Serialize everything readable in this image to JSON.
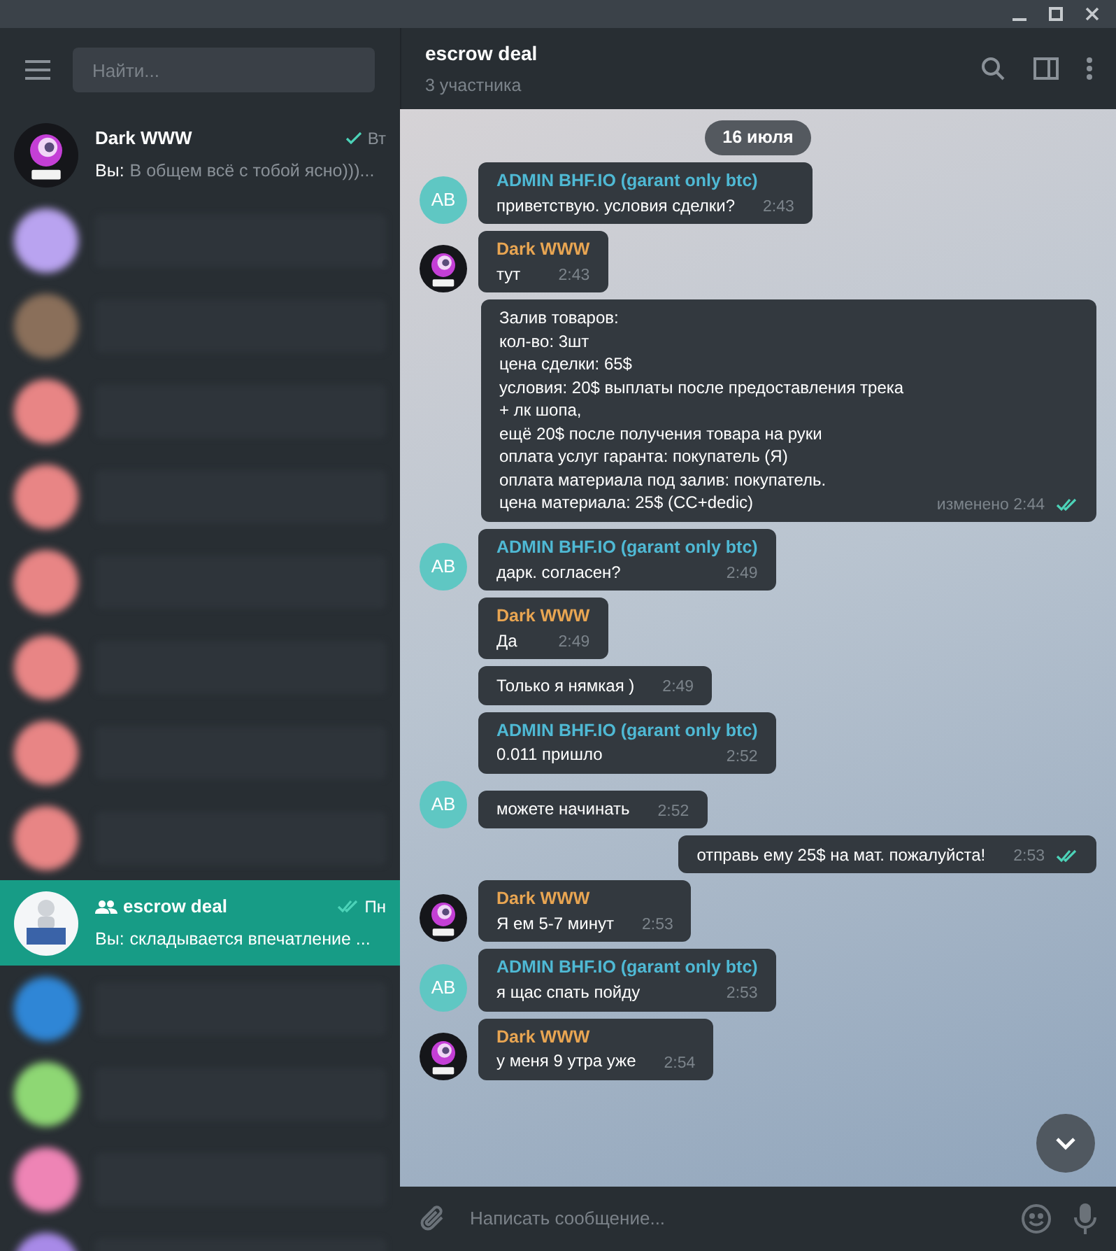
{
  "sidebar": {
    "search": {
      "placeholder": "Найти..."
    },
    "chats": [
      {
        "kind": "chat",
        "name": "Dark WWW",
        "prefix": "Вы:",
        "preview": "В общем всё с тобой ясно)))...",
        "time": "Вт",
        "read": false,
        "selected": false,
        "avatar": {
          "kind": "logo"
        }
      },
      {
        "kind": "blurred",
        "color": "#b9a3f0"
      },
      {
        "kind": "blurred",
        "color": "#8a6f5a"
      },
      {
        "kind": "blurred",
        "color": "#e88585"
      },
      {
        "kind": "blurred",
        "color": "#e88585"
      },
      {
        "kind": "blurred",
        "color": "#e88585"
      },
      {
        "kind": "blurred",
        "color": "#e88585"
      },
      {
        "kind": "blurred",
        "color": "#e88585"
      },
      {
        "kind": "blurred",
        "color": "#e88585"
      },
      {
        "kind": "group",
        "name": "escrow deal",
        "prefix": "Вы:",
        "preview": "складывается впечатление ...",
        "time": "Пн",
        "read": true,
        "selected": true,
        "avatar": {
          "kind": "escrow"
        }
      },
      {
        "kind": "blurred",
        "color": "#2f86d6"
      },
      {
        "kind": "blurred",
        "color": "#8ed774"
      },
      {
        "kind": "blurred",
        "color": "#ee84b5"
      },
      {
        "kind": "blurred",
        "color": "#a88ae8"
      }
    ]
  },
  "chat": {
    "title": "escrow deal",
    "subtitle": "3 участника",
    "date": "16 июля",
    "messages": [
      {
        "out": false,
        "sender": "ADMIN BHF.IO (garant only btc)",
        "color": "#4fb9d4",
        "text": "приветствую. условия сделки?",
        "time": "2:43",
        "avatar": {
          "kind": "initials",
          "text": "AB"
        }
      },
      {
        "out": false,
        "sender": "Dark WWW",
        "color": "#e8a552",
        "text": "тут",
        "time": "2:43",
        "avatar": {
          "kind": "logo"
        }
      },
      {
        "out": true,
        "text": "Залив товаров:\nкол-во: 3шт\nцена сделки: 65$\nусловия: 20$ выплаты после предоставления трека + лк шопа,\nещё 20$ после получения товара на руки\nоплата услуг гаранта: покупатель (Я)\nоплата материала под залив: покупатель.\nцена материала: 25$ (CC+dedic)",
        "time": "изменено 2:44",
        "read": true
      },
      {
        "out": false,
        "sender": "ADMIN BHF.IO (garant only btc)",
        "color": "#4fb9d4",
        "text": "дарк. согласен?",
        "time": "2:49",
        "avatar": {
          "kind": "initials",
          "text": "AB"
        }
      },
      {
        "out": false,
        "sender": "Dark WWW",
        "color": "#e8a552",
        "text": "Да",
        "time": "2:49"
      },
      {
        "out": false,
        "text": "Только я нямкая )",
        "time": "2:49"
      },
      {
        "out": false,
        "sender": "ADMIN BHF.IO (garant only btc)",
        "color": "#4fb9d4",
        "text": "0.011 пришло",
        "time": "2:52"
      },
      {
        "out": false,
        "text": "можете начинать",
        "time": "2:52",
        "avatar": {
          "kind": "initials",
          "text": "AB"
        }
      },
      {
        "out": true,
        "text": "отправь ему 25$ на мат. пожалуйста!",
        "time": "2:53",
        "read": true
      },
      {
        "out": false,
        "sender": "Dark WWW",
        "color": "#e8a552",
        "text": "Я ем 5-7 минут",
        "time": "2:53",
        "avatar": {
          "kind": "logo"
        }
      },
      {
        "out": false,
        "sender": "ADMIN BHF.IO (garant only btc)",
        "color": "#4fb9d4",
        "text": "я щас спать пойду",
        "time": "2:53",
        "avatar": {
          "kind": "initials",
          "text": "AB"
        }
      },
      {
        "out": false,
        "sender": "Dark WWW",
        "color": "#e8a552",
        "text": "у меня 9 утра уже",
        "time": "2:54",
        "avatar": {
          "kind": "logo"
        }
      }
    ],
    "composer": {
      "placeholder": "Написать сообщение..."
    }
  }
}
